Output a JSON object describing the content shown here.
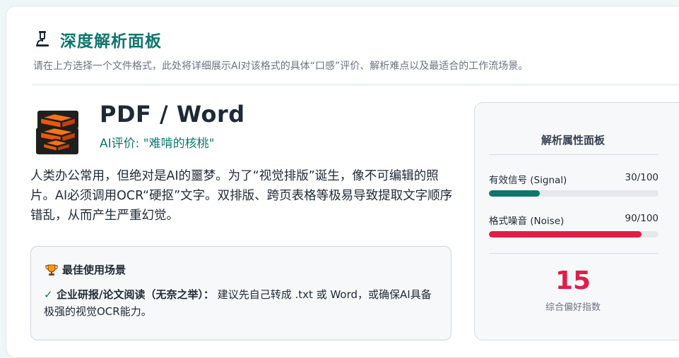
{
  "header": {
    "icon": "microscope-icon",
    "title": "深度解析面板",
    "subtitle": "请在上方选择一个文件格式，此处将详细展示AI对该格式的具体“口感”评价、解析难点以及最适合的工作流场景。"
  },
  "format": {
    "icon": "bricks-icon",
    "name": "PDF / Word",
    "evaluation": "AI评价: \"难啃的核桃\"",
    "description": "人类办公常用，但绝对是AI的噩梦。为了“视觉排版”诞生，像不可编辑的照片。AI必须调用OCR“硬抠”文字。双排版、跨页表格等极易导致提取文字顺序错乱，从而产生严重幻觉。"
  },
  "scenario": {
    "icon": "trophy-icon",
    "title": "最佳使用场景",
    "check_icon": "check-icon",
    "label": "企业研报/论文阅读（无奈之举）：",
    "text": " 建议先自己转成 .txt 或 Word，或确保AI具备极强的视觉OCR能力。"
  },
  "panel": {
    "title": "解析属性面板",
    "metrics": [
      {
        "label": "有效信号 (Signal)",
        "value_text": "30/100",
        "value": 30,
        "max": 100,
        "color": "#0f766e"
      },
      {
        "label": "格式噪音 (Noise)",
        "value_text": "90/100",
        "value": 90,
        "max": 100,
        "color": "#e11d48"
      }
    ],
    "score": "15",
    "score_label": "综合偏好指数"
  },
  "colors": {
    "accent": "#0f766e",
    "danger": "#e11d48"
  }
}
